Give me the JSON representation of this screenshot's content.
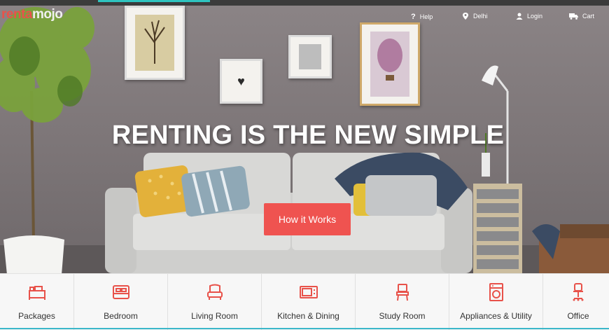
{
  "brand": {
    "logo_text_1": "renta",
    "logo_text_2": "mojo"
  },
  "nav": {
    "help": "Help",
    "location": "Delhi",
    "login": "Login",
    "cart": "Cart"
  },
  "hero": {
    "headline": "RENTING IS THE NEW SIMPLE",
    "cta_label": "How it Works"
  },
  "categories": [
    {
      "label": "Packages",
      "icon": "packages-icon"
    },
    {
      "label": "Bedroom",
      "icon": "bed-icon"
    },
    {
      "label": "Living Room",
      "icon": "armchair-icon"
    },
    {
      "label": "Kitchen & Dining",
      "icon": "microwave-icon"
    },
    {
      "label": "Study Room",
      "icon": "study-chair-icon"
    },
    {
      "label": "Appliances & Utility",
      "icon": "washing-machine-icon"
    },
    {
      "label": "Office",
      "icon": "office-chair-icon"
    }
  ],
  "colors": {
    "accent": "#ef5350",
    "teal": "#2ec4c0",
    "icon": "#e8524a"
  }
}
